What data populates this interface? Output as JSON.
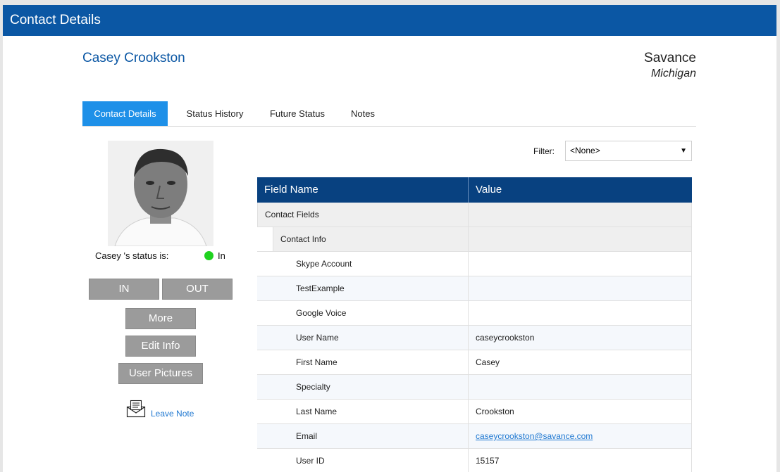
{
  "window": {
    "title": "Contact Details"
  },
  "contact": {
    "name": "Casey Crookston",
    "company": "Savance",
    "location": "Michigan",
    "status_text": "Casey 's status is:",
    "status_value": "In",
    "status_color": "#1fd21f"
  },
  "tabs": [
    {
      "label": "Contact Details",
      "active": true
    },
    {
      "label": "Status History",
      "active": false
    },
    {
      "label": "Future Status",
      "active": false
    },
    {
      "label": "Notes",
      "active": false
    }
  ],
  "buttons": {
    "in": "IN",
    "out": "OUT",
    "more": "More",
    "edit_info": "Edit Info",
    "user_pictures": "User Pictures",
    "leave_note": "Leave Note"
  },
  "filter": {
    "label": "Filter:",
    "selected": "<None>"
  },
  "grid": {
    "headers": {
      "field": "Field Name",
      "value": "Value"
    },
    "group": "Contact Fields",
    "subgroup": "Contact Info",
    "rows": [
      {
        "field": "Skype Account",
        "value": ""
      },
      {
        "field": "TestExample",
        "value": ""
      },
      {
        "field": "Google Voice",
        "value": ""
      },
      {
        "field": "User Name",
        "value": "caseycrookston"
      },
      {
        "field": "First Name",
        "value": "Casey"
      },
      {
        "field": "Specialty",
        "value": ""
      },
      {
        "field": "Last Name",
        "value": "Crookston"
      },
      {
        "field": "Email",
        "value": "caseycrookston@savance.com"
      },
      {
        "field": "User ID",
        "value": "15157"
      }
    ]
  },
  "colors": {
    "titlebar": "#0b57a4",
    "accent_tab": "#1e90e8",
    "grid_header": "#084180"
  }
}
